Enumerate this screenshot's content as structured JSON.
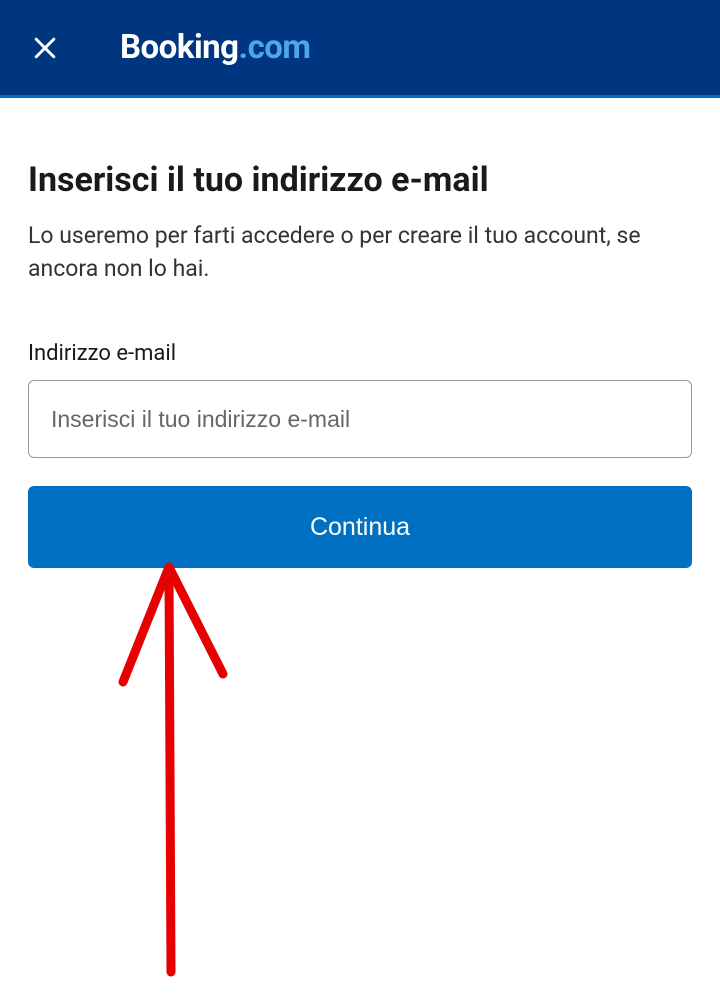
{
  "header": {
    "logo": {
      "part1": "Booking",
      "part2": ".com"
    }
  },
  "main": {
    "heading": "Inserisci il tuo indirizzo e-mail",
    "subheading": "Lo useremo per farti accedere o per creare il tuo account, se ancora non lo hai.",
    "email_label": "Indirizzo e-mail",
    "email_placeholder": "Inserisci il tuo indirizzo e-mail",
    "continue_label": "Continua"
  }
}
